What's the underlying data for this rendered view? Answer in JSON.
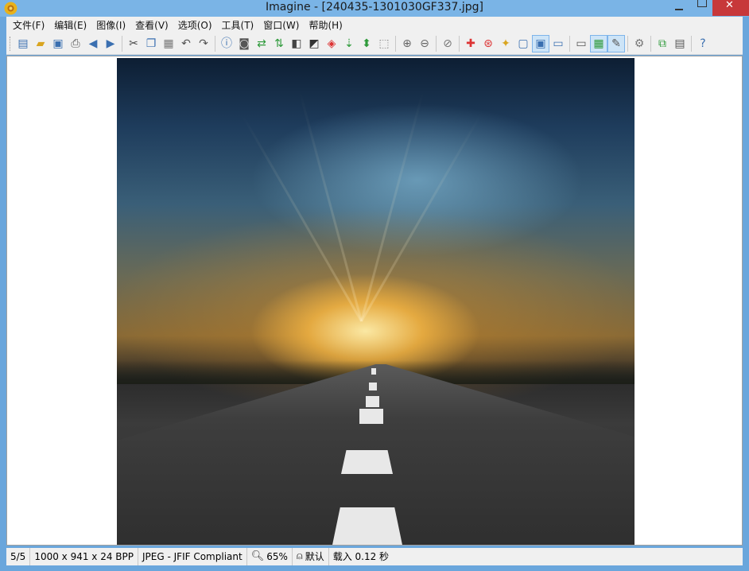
{
  "window": {
    "title": "Imagine - [240435-1301030GF337.jpg]"
  },
  "menu": [
    {
      "id": "file",
      "label": "文件(F)"
    },
    {
      "id": "edit",
      "label": "编辑(E)"
    },
    {
      "id": "image",
      "label": "图像(I)"
    },
    {
      "id": "view",
      "label": "查看(V)"
    },
    {
      "id": "options",
      "label": "选项(O)"
    },
    {
      "id": "tools",
      "label": "工具(T)"
    },
    {
      "id": "window",
      "label": "窗口(W)"
    },
    {
      "id": "help",
      "label": "帮助(H)"
    }
  ],
  "toolbar": {
    "icons": [
      "new-icon",
      "open-folder-icon",
      "save-icon",
      "print-icon",
      "prev-arrow-icon",
      "next-arrow-icon",
      "cut-icon",
      "copy-icon",
      "paste-icon",
      "undo-icon",
      "redo-icon",
      "info-icon",
      "camera-icon",
      "rotate-icon",
      "flip-icon",
      "grayscale-icon",
      "adjust-icon",
      "color-icon",
      "effects-icon",
      "resize-icon",
      "crop-icon",
      "zoom-in-icon",
      "zoom-out-icon",
      "zoom-fit-icon",
      "actual-size-icon",
      "fullscreen-icon",
      "slideshow-icon",
      "monitor-icon",
      "thumbnails-icon",
      "brush-icon",
      "settings-icon",
      "plugin-icon",
      "screenshot-icon",
      "help-icon"
    ],
    "pressed": [
      "fullscreen-icon",
      "thumbnails-icon",
      "brush-icon"
    ]
  },
  "status": {
    "position": "5/5",
    "dimensions": "1000 x 941 x 24 BPP",
    "format": "JPEG - JFIF Compliant",
    "zoom": "65%",
    "mode": "默认",
    "load_time": "载入 0.12 秒"
  },
  "colors": {
    "titlebar": "#7ab4e6",
    "close_button": "#c7383a",
    "chrome": "#f0f0f0"
  }
}
